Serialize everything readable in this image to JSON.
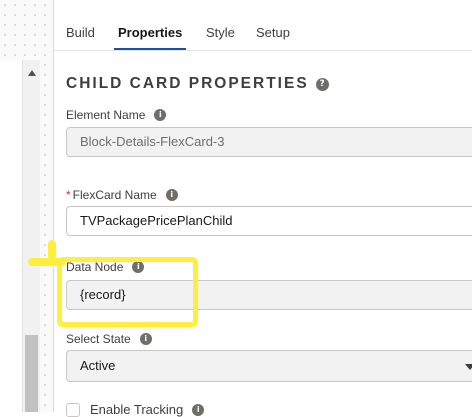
{
  "tabs": [
    {
      "label": "Build",
      "active": false
    },
    {
      "label": "Properties",
      "active": true
    },
    {
      "label": "Style",
      "active": false
    },
    {
      "label": "Setup",
      "active": false
    }
  ],
  "section": {
    "title": "CHILD CARD PROPERTIES",
    "help_icon": "question-icon",
    "help_glyph": "?"
  },
  "info_glyph": "i",
  "fields": {
    "element_name": {
      "label": "Element Name",
      "value": "Block-Details-FlexCard-3",
      "disabled": true,
      "icon": "info-icon"
    },
    "flexcard_name": {
      "label": "FlexCard Name",
      "required_marker": "*",
      "value": "TVPackagePricePlanChild",
      "icon": "info-icon"
    },
    "data_node": {
      "label": "Data Node",
      "value": "{record}",
      "icon": "info-icon"
    },
    "select_state": {
      "label": "Select State",
      "value": "Active",
      "icon": "info-icon"
    },
    "enable_tracking": {
      "label": "Enable Tracking",
      "checked": false,
      "icon": "info-icon"
    }
  },
  "colors": {
    "active_tab_underline": "#1b5297",
    "highlight": "#ffee3c",
    "required": "#c23934"
  }
}
